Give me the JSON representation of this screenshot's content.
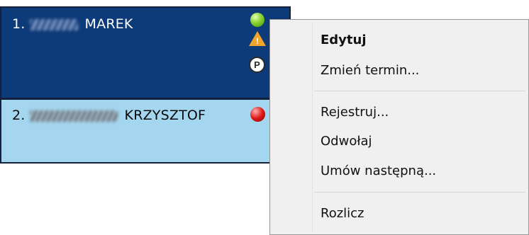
{
  "schedule": {
    "rows": [
      {
        "number": "1.",
        "name": "MAREK",
        "status": "green",
        "row_color": "#0d3a78"
      },
      {
        "number": "2.",
        "name": "KRZYSZTOF",
        "status": "red",
        "row_color": "#a4d6ef"
      }
    ],
    "indicators": {
      "warning_symbol": "!",
      "parking_symbol": "P"
    }
  },
  "context_menu": {
    "items": [
      {
        "label": "Edytuj",
        "bold": true
      },
      {
        "label": "Zmień termin..."
      },
      {
        "label": "Rejestruj..."
      },
      {
        "label": "Odwołaj"
      },
      {
        "label": "Umów następną..."
      },
      {
        "label": "Rozlicz"
      }
    ]
  }
}
